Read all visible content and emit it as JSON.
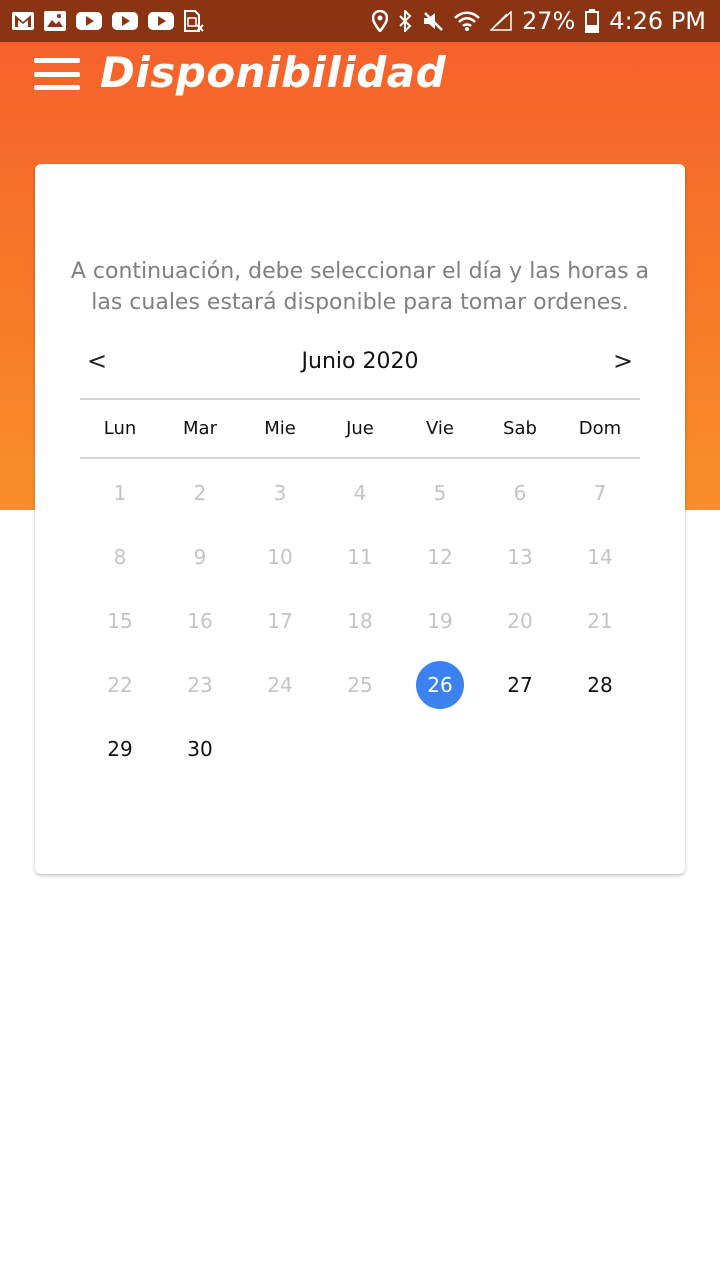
{
  "status_bar": {
    "left_icons": [
      "gmail-icon",
      "gallery-icon",
      "youtube-icon",
      "youtube-icon",
      "youtube-icon",
      "sim-error-icon"
    ],
    "right_icons": [
      "location-icon",
      "bluetooth-icon",
      "mute-icon",
      "wifi-icon",
      "signal-icon",
      "battery-icon"
    ],
    "battery": "27%",
    "time": "4:26 PM"
  },
  "app_bar": {
    "title": "Disponibilidad",
    "menu_icon": "hamburger-menu-icon"
  },
  "colors": {
    "status_bar": "#8b3414",
    "header_top": "#f6612b",
    "header_bottom": "#f8902a",
    "selected_day": "#3b82f0",
    "disabled_day": "#c4c4c4"
  },
  "card": {
    "instructions": "A continuación, debe seleccionar el día y las horas a las cuales estará disponible para tomar ordenes."
  },
  "calendar": {
    "prev_label": "<",
    "next_label": ">",
    "month_label": "Junio 2020",
    "weekdays": [
      "Lun",
      "Mar",
      "Mie",
      "Jue",
      "Vie",
      "Sab",
      "Dom"
    ],
    "days": [
      {
        "label": "1",
        "state": "disabled"
      },
      {
        "label": "2",
        "state": "disabled"
      },
      {
        "label": "3",
        "state": "disabled"
      },
      {
        "label": "4",
        "state": "disabled"
      },
      {
        "label": "5",
        "state": "disabled"
      },
      {
        "label": "6",
        "state": "disabled"
      },
      {
        "label": "7",
        "state": "disabled"
      },
      {
        "label": "8",
        "state": "disabled"
      },
      {
        "label": "9",
        "state": "disabled"
      },
      {
        "label": "10",
        "state": "disabled"
      },
      {
        "label": "11",
        "state": "disabled"
      },
      {
        "label": "12",
        "state": "disabled"
      },
      {
        "label": "13",
        "state": "disabled"
      },
      {
        "label": "14",
        "state": "disabled"
      },
      {
        "label": "15",
        "state": "disabled"
      },
      {
        "label": "16",
        "state": "disabled"
      },
      {
        "label": "17",
        "state": "disabled"
      },
      {
        "label": "18",
        "state": "disabled"
      },
      {
        "label": "19",
        "state": "disabled"
      },
      {
        "label": "20",
        "state": "disabled"
      },
      {
        "label": "21",
        "state": "disabled"
      },
      {
        "label": "22",
        "state": "disabled"
      },
      {
        "label": "23",
        "state": "disabled"
      },
      {
        "label": "24",
        "state": "disabled"
      },
      {
        "label": "25",
        "state": "disabled"
      },
      {
        "label": "26",
        "state": "selected"
      },
      {
        "label": "27",
        "state": "enabled"
      },
      {
        "label": "28",
        "state": "enabled"
      },
      {
        "label": "29",
        "state": "enabled"
      },
      {
        "label": "30",
        "state": "enabled"
      }
    ]
  }
}
